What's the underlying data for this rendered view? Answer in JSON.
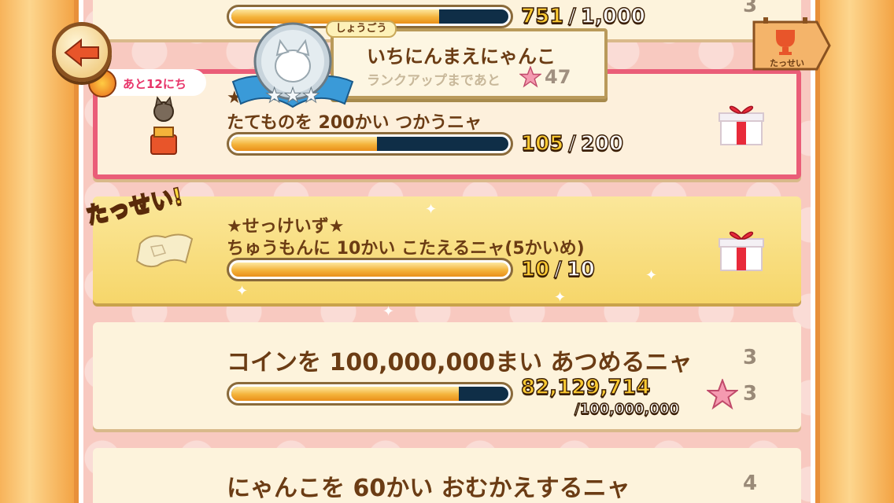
{
  "back_button": {
    "label": "back"
  },
  "deadline": {
    "label": "あと12にち"
  },
  "rank": {
    "tag": "しょうごう",
    "title": "いちにんまえにゃんこ",
    "sub": "ランクアップまであと",
    "value": "47"
  },
  "achieved_button": {
    "label": "たっせい"
  },
  "missions": [
    {
      "title_line1": "",
      "current": "751",
      "total": "1,000",
      "progress": 0.751,
      "count": "3"
    },
    {
      "title_line1": "★",
      "title_line2": "たてものを 200かい つかうニャ",
      "current": "105",
      "total": "200",
      "progress": 0.525
    },
    {
      "stamp": "たっせい!",
      "title_line1": "★せっけいず★",
      "title_line2": "ちゅうもんに 10かい こたえるニャ(5かいめ)",
      "current": "10",
      "total": "10",
      "progress": 1.0
    },
    {
      "title": "コインを 100,000,000まい あつめるニャ",
      "current": "82,129,714",
      "total": "/100,000,000",
      "progress": 0.8213,
      "count": "3",
      "reward": "3"
    },
    {
      "title": "にゃんこを 60かい おむかえするニャ",
      "count": "4"
    }
  ],
  "colors": {
    "accent_pink": "#ea5d78",
    "bar_fill": "#f4b33a",
    "bar_track": "#0f2e47",
    "text_brown": "#6b3c14"
  }
}
